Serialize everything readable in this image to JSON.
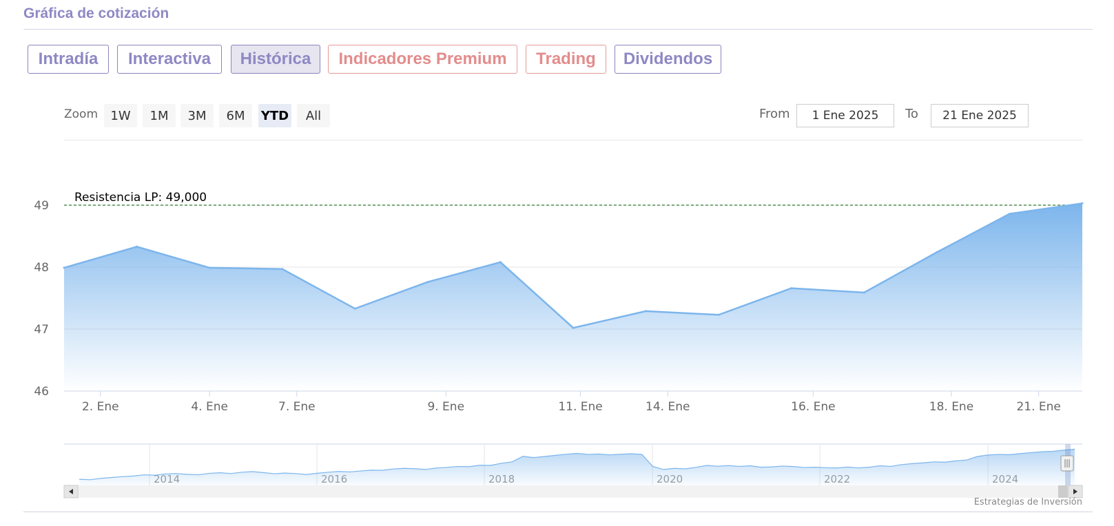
{
  "section_title": "Gráfica de cotización",
  "tabs": [
    {
      "label": "Intradía",
      "active": false,
      "premium": false
    },
    {
      "label": "Interactiva",
      "active": false,
      "premium": false
    },
    {
      "label": "Histórica",
      "active": true,
      "premium": false
    },
    {
      "label": "Indicadores Premium",
      "active": false,
      "premium": true
    },
    {
      "label": "Trading",
      "active": false,
      "premium": true
    },
    {
      "label": "Dividendos",
      "active": false,
      "premium": false
    }
  ],
  "zoom": {
    "label": "Zoom",
    "buttons": [
      "1W",
      "1M",
      "3M",
      "6M",
      "YTD",
      "All"
    ],
    "selected": "YTD"
  },
  "range": {
    "from_label": "From",
    "from_value": "1 Ene 2025",
    "to_label": "To",
    "to_value": "21 Ene 2025"
  },
  "credit": "Estrategias de Inversión",
  "colors": {
    "accent": "#8e88c4",
    "premium": "#e38c8c",
    "series": "#7cb5ec",
    "resistance": "#2a7a2a"
  },
  "chart_data": {
    "type": "area",
    "ylim": [
      46,
      49
    ],
    "yticks": [
      46,
      47,
      48,
      49
    ],
    "x": [
      1,
      2,
      3,
      4,
      5,
      6,
      7,
      8,
      9,
      10,
      11,
      12,
      13,
      14,
      15
    ],
    "values": [
      47.99,
      48.33,
      47.99,
      47.97,
      47.33,
      47.76,
      48.08,
      47.02,
      47.29,
      47.23,
      47.66,
      47.59,
      48.24,
      48.86,
      49.03
    ],
    "xticks": [
      {
        "x": 1.5,
        "label": "2. Ene"
      },
      {
        "x": 3.0,
        "label": "4. Ene"
      },
      {
        "x": 4.2,
        "label": "7. Ene"
      },
      {
        "x": 6.25,
        "label": "9. Ene"
      },
      {
        "x": 8.1,
        "label": "11. Ene"
      },
      {
        "x": 9.3,
        "label": "14. Ene"
      },
      {
        "x": 11.3,
        "label": "16. Ene"
      },
      {
        "x": 13.2,
        "label": "18. Ene"
      },
      {
        "x": 14.4,
        "label": "21. Ene"
      }
    ],
    "plot_line": {
      "value": 49.0,
      "label": "Resistencia LP: 49,000"
    },
    "navigator": {
      "year_labels": [
        "2014",
        "2016",
        "2018",
        "2020",
        "2022",
        "2024"
      ],
      "series": [
        30.5,
        30.2,
        31,
        31.6,
        32.1,
        32.5,
        33.2,
        33.0,
        33.8,
        34.0,
        33.5,
        33.2,
        34.1,
        34.5,
        34.0,
        34.8,
        35.2,
        34.6,
        33.9,
        34.3,
        34.0,
        33.4,
        34.2,
        34.8,
        35.3,
        35.0,
        35.6,
        36.1,
        36.0,
        36.8,
        37.2,
        37.0,
        36.5,
        37.4,
        37.8,
        38.4,
        38.2,
        39.1,
        39.0,
        40.3,
        41.2,
        44.6,
        43.8,
        44.5,
        45.2,
        45.9,
        46.4,
        45.8,
        46.0,
        45.5,
        45.9,
        46.2,
        45.8,
        38.4,
        36.5,
        37.2,
        36.9,
        37.8,
        39.0,
        38.5,
        38.9,
        38.4,
        38.8,
        37.9,
        38.1,
        38.6,
        38.3,
        37.7,
        37.9,
        37.6,
        37.4,
        38.0,
        37.5,
        37.9,
        38.8,
        38.4,
        39.5,
        40.1,
        40.6,
        41.2,
        41.0,
        41.8,
        42.3,
        44.5,
        45.4,
        45.8,
        45.6,
        46.3,
        46.9,
        47.4,
        47.7,
        48.4,
        49.0
      ]
    }
  }
}
